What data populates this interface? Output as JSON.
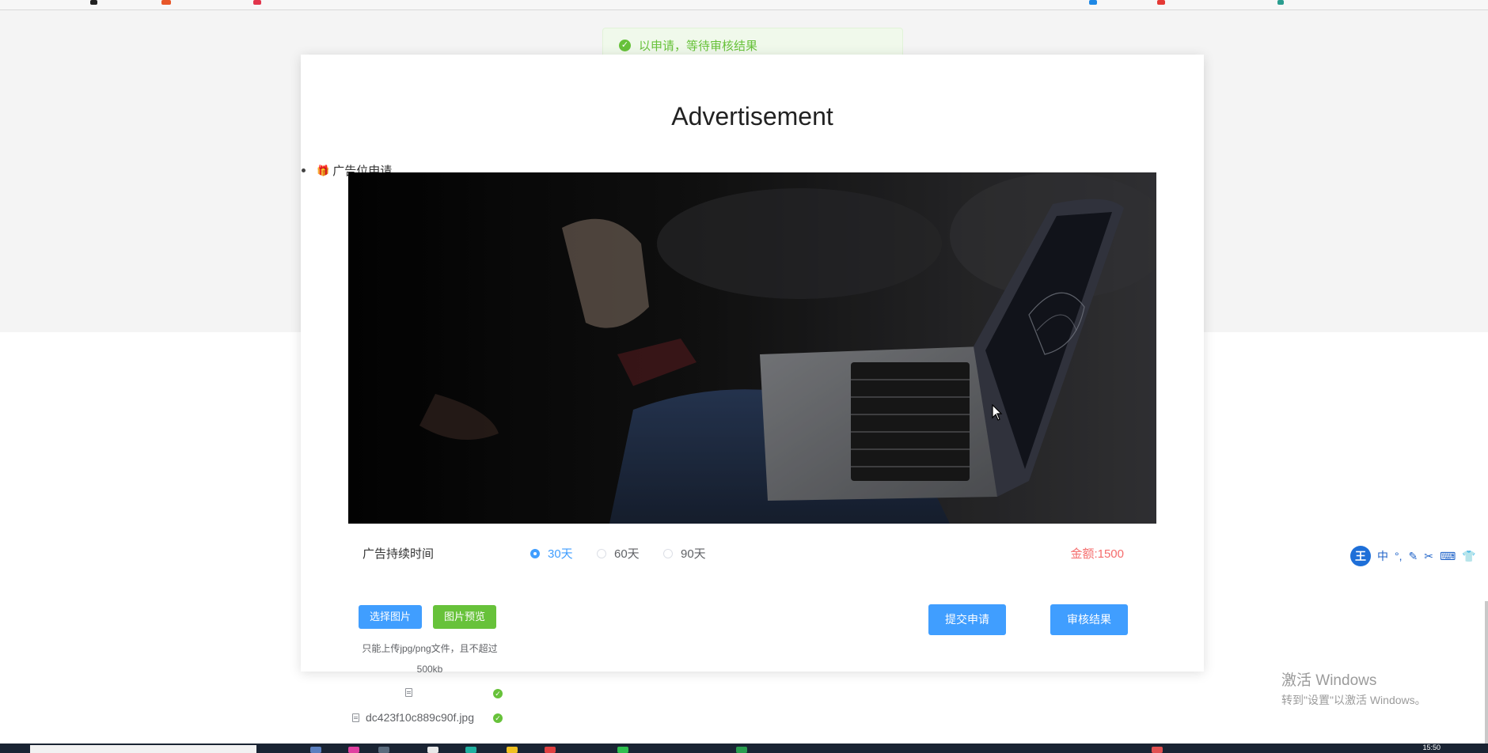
{
  "toast": {
    "message": "以申请，等待审核结果"
  },
  "card": {
    "title": "Advertisement",
    "menu_item": "广告位申请",
    "image_alt": "laptop-photo",
    "duration": {
      "label": "广告持续时间",
      "options": [
        "30天",
        "60天",
        "90天"
      ],
      "selected": "30天"
    },
    "amount": "金额:1500",
    "buttons": {
      "choose_image": "选择图片",
      "preview_image": "图片预览",
      "submit": "提交申请",
      "review_result": "审核结果"
    },
    "upload_hint": "只能上传jpg/png文件，且不超过500kb",
    "files": [
      "",
      "dc423f10c889c90f.jpg"
    ]
  },
  "watermark": {
    "line1": "激活 Windows",
    "line2": "转到\"设置\"以激活 Windows。"
  },
  "ime_toolbar": {
    "logo": "王",
    "lang": "中",
    "punct": "°,"
  },
  "clock": "15:50",
  "colors": {
    "primary": "#409eff",
    "success": "#67c23a",
    "danger": "#f56c6c",
    "toast_bg": "#f0f9eb"
  }
}
